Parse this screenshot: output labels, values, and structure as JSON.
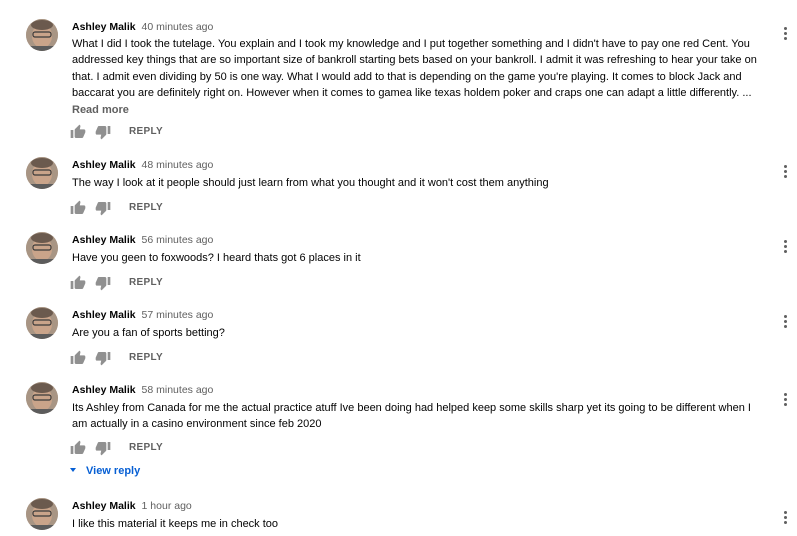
{
  "comments": [
    {
      "author": "Ashley Malik",
      "timestamp": "40 minutes ago",
      "text": "What I did I took the tutelage. You explain and I took my knowledge and I put together something and I didn't have to pay one red Cent. You addressed key things that are so important size of bankroll starting bets based on your bankroll. I admit it was refreshing to hear your take on that.  I  admit even dividing by 50 is one way. What I would add to that is depending on the game you're playing. It comes to block Jack and baccarat you are definitely right on. However when it comes to gamea like texas holdem poker and craps one can adapt a little differently. ...",
      "read_more": "Read more",
      "reply_label": "REPLY"
    },
    {
      "author": "Ashley Malik",
      "timestamp": "48 minutes ago",
      "text": "The way I look at it people should just learn from what you thought and it won't cost them anything",
      "reply_label": "REPLY"
    },
    {
      "author": "Ashley Malik",
      "timestamp": "56 minutes ago",
      "text": "Have you geen to foxwoods? I heard thats got 6 places in it",
      "reply_label": "REPLY"
    },
    {
      "author": "Ashley Malik",
      "timestamp": "57 minutes ago",
      "text": "Are you a fan of sports betting?",
      "reply_label": "REPLY"
    },
    {
      "author": "Ashley Malik",
      "timestamp": "58 minutes ago",
      "text": "Its Ashley from Canada for me the actual practice atuff Ive been doing had helped keep some skills sharp yet its going to be different when I am actually in a casino environment since feb 2020",
      "reply_label": "REPLY",
      "view_reply_label": "View reply"
    },
    {
      "author": "Ashley Malik",
      "timestamp": "1 hour ago",
      "text": "I like this material it keeps me in check too"
    }
  ],
  "icons": {
    "like": "thumb-up-icon",
    "dislike": "thumb-down-icon",
    "menu": "more-vertical-icon",
    "expand": "caret-down-icon"
  },
  "colors": {
    "link": "#065fd4",
    "secondary_text": "#606060",
    "primary_text": "#030303"
  }
}
